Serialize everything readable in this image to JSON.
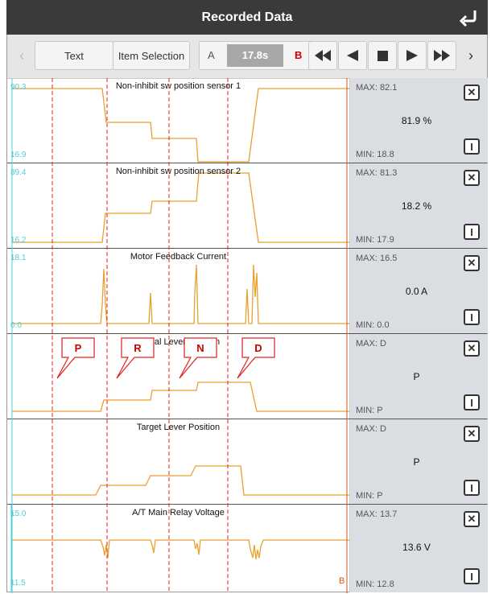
{
  "header": {
    "title": "Recorded Data"
  },
  "toolbar": {
    "text_label": "Text",
    "item_selection_label": "Item Selection",
    "a_label": "A",
    "time": "17.8s",
    "b_label": "B"
  },
  "panels": [
    {
      "name": "Non-inhibit sw position sensor 1",
      "y_top": "90.3",
      "y_bottom": "16.9",
      "max": "MAX: 82.1",
      "value": "81.9 %",
      "min": "MIN: 18.8"
    },
    {
      "name": "Non-inhibit sw position sensor 2",
      "y_top": "89.4",
      "y_bottom": "16.2",
      "max": "MAX: 81.3",
      "value": "18.2 %",
      "min": "MIN: 17.9"
    },
    {
      "name": "Motor Feedback Current",
      "y_top": "18.1",
      "y_bottom": "0.0",
      "max": "MAX: 16.5",
      "value": "0.0 A",
      "min": "MIN: 0.0"
    },
    {
      "name": "Actual Lever Position",
      "y_top": "",
      "y_bottom": "",
      "max": "MAX: D",
      "value": "P",
      "min": "MIN: P"
    },
    {
      "name": "Target Lever Position",
      "y_top": "",
      "y_bottom": "",
      "max": "MAX: D",
      "value": "P",
      "min": "MIN: P"
    },
    {
      "name": "A/T Main Relay Voltage",
      "y_top": "15.0",
      "y_bottom": "11.5",
      "max": "MAX: 13.7",
      "value": "13.6 V",
      "min": "MIN: 12.8"
    }
  ],
  "callouts": [
    "P",
    "R",
    "N",
    "D"
  ],
  "b_marker": "B",
  "colors": {
    "trace": "#e8a12c",
    "marker": "#e02020",
    "axis_label": "#4ccfd8",
    "title_bar": "#3a3a3a",
    "side_panel": "#dadee2"
  }
}
